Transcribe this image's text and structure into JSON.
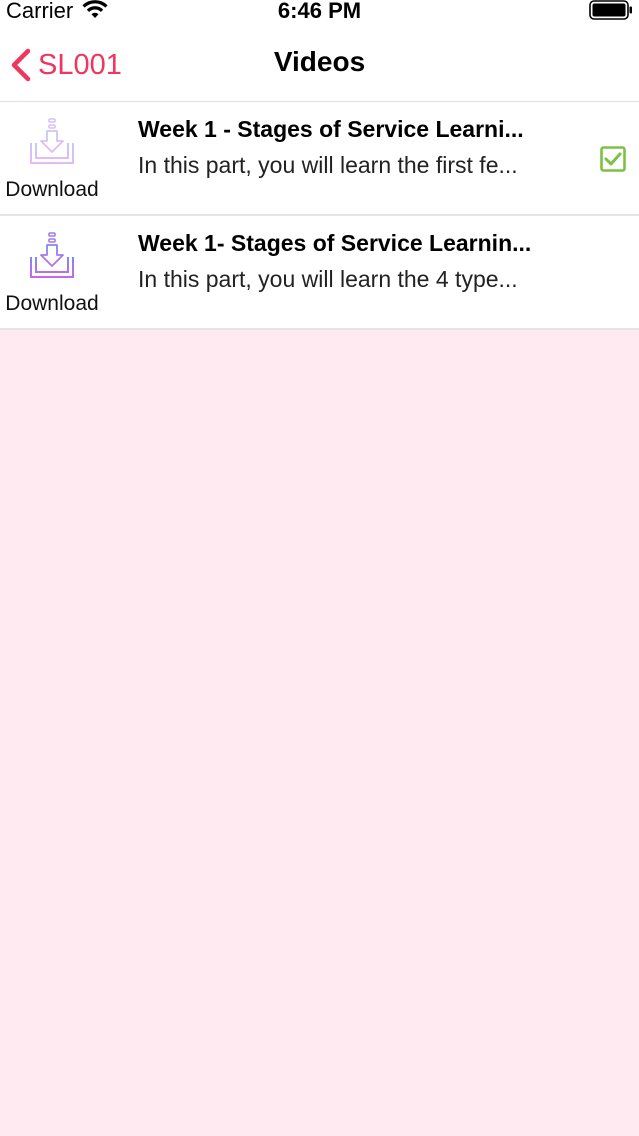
{
  "status_bar": {
    "carrier": "Carrier",
    "time": "6:46 PM",
    "icons": [
      "wifi-icon",
      "battery-icon"
    ]
  },
  "nav": {
    "back_label": "SL001",
    "title": "Videos",
    "accent_color": "#f0355e"
  },
  "videos": [
    {
      "title": "Week 1 - Stages of Service Learni...",
      "description": "In this part, you will learn the first fe...",
      "download_label": "Download",
      "download_icon": "download-icon",
      "completed": true
    },
    {
      "title": "Week 1- Stages of Service Learnin...",
      "description": "In this part, you will learn the 4 type...",
      "download_label": "Download",
      "download_icon": "download-icon",
      "completed": false
    }
  ],
  "colors": {
    "background": "#ffeaf1",
    "check": "#7cc242",
    "download_icon_top": "#7a8cf0",
    "download_icon_bottom": "#c768e8"
  }
}
